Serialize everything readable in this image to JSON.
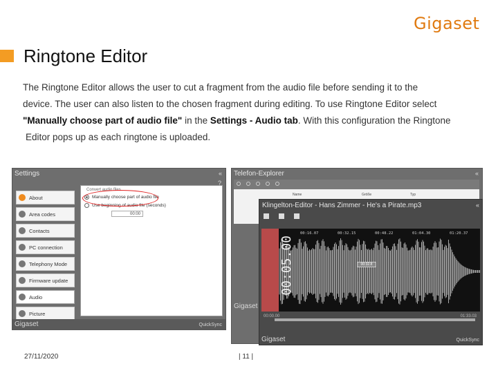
{
  "brand": {
    "logo_text": "Gigaset",
    "accent_color": "#f39c23"
  },
  "slide": {
    "title": "Ringtone Editor",
    "para_line1": "The Ringtone Editor allows the user to cut a fragment from the audio file before sending it to the",
    "para_line2": "device. The user can also listen to the chosen fragment during editing. To use Ringtone Editor select",
    "para_bold1": "\"Manually choose part of audio file\"",
    "para_mid": " in the ",
    "para_bold2": "Settings - Audio tab",
    "para_end": ". With this configuration the Ringtone",
    "para_line4": "Editor pops up as each ringtone is uploaded."
  },
  "settings_window": {
    "title": "Settings",
    "collapse_glyph": "«",
    "help_glyph": "?",
    "nav_items": [
      {
        "label": "About"
      },
      {
        "label": "Area codes"
      },
      {
        "label": "Contacts"
      },
      {
        "label": "PC connection"
      },
      {
        "label": "Telephony Mode"
      },
      {
        "label": "Firmware update"
      },
      {
        "label": "Audio"
      },
      {
        "label": "Picture"
      }
    ],
    "group_label": "Convert audio files",
    "option_manual": "Manually choose part of audio file",
    "option_auto": "Use beginning of audio file (seconds)",
    "seconds_value": "00:00",
    "footer_brand": "Gigaset",
    "footer_sync": "QuickSync"
  },
  "explorer_window": {
    "title": "Telefon-Explorer",
    "collapse_glyph": "«",
    "col_name": "Name",
    "col_size": "Größe",
    "col_type": "Typ",
    "footer_brand": "Gigaset"
  },
  "editor_window": {
    "title": "Klingelton-Editor - Hans Zimmer - He's a Pirate.mp3",
    "collapse_glyph": "«",
    "big_time": "00:05.00",
    "tick_labels": [
      "00:16.07",
      "00:32.15",
      "00:48.22",
      "01:04.30",
      "01:20.37"
    ],
    "cursor_label": "00:32.8",
    "time_left": "00:00.00",
    "time_right": "01:33.03",
    "footer_brand": "Gigaset",
    "footer_sync": "QuickSync"
  },
  "footer": {
    "date": "27/11/2020",
    "page": "| 11 |"
  }
}
